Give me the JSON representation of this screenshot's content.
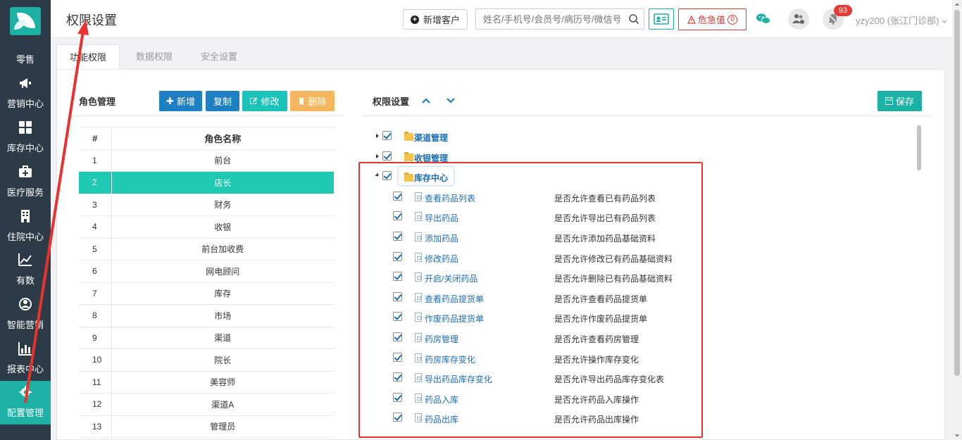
{
  "sidebar": {
    "items": [
      {
        "label": "零售",
        "icon": "retail-icon"
      },
      {
        "label": "营销中心",
        "icon": "megaphone-icon"
      },
      {
        "label": "库存中心",
        "icon": "grid-icon"
      },
      {
        "label": "医疗服务",
        "icon": "medical-kit-icon"
      },
      {
        "label": "住院中心",
        "icon": "building-icon"
      },
      {
        "label": "有数",
        "icon": "trend-chart-icon"
      },
      {
        "label": "智能营销",
        "icon": "smart-marketing-icon"
      },
      {
        "label": "报表中心",
        "icon": "bar-chart-icon"
      },
      {
        "label": "配置管理",
        "icon": "gear-icon"
      }
    ]
  },
  "header": {
    "title": "权限设置",
    "add_customer": "新增客户",
    "search_placeholder": "姓名/手机号/会员号/病历号/微信号",
    "danger_label": "危急值",
    "danger_count": "0",
    "notification_count": "93",
    "user": "yzy200 (张江门诊部)"
  },
  "tabs": [
    "功能权限",
    "数据权限",
    "安全设置"
  ],
  "role_panel": {
    "title": "角色管理",
    "buttons": {
      "add": "新增",
      "copy": "复制",
      "edit": "修改",
      "delete": "删除"
    },
    "columns": [
      "#",
      "角色名称"
    ],
    "rows": [
      {
        "num": "1",
        "name": "前台"
      },
      {
        "num": "2",
        "name": "店长"
      },
      {
        "num": "3",
        "name": "财务"
      },
      {
        "num": "4",
        "name": "收银"
      },
      {
        "num": "5",
        "name": "前台加收费"
      },
      {
        "num": "6",
        "name": "网电顾问"
      },
      {
        "num": "7",
        "name": "库存"
      },
      {
        "num": "8",
        "name": "市场"
      },
      {
        "num": "9",
        "name": "渠道"
      },
      {
        "num": "10",
        "name": "院长"
      },
      {
        "num": "11",
        "name": "美容师"
      },
      {
        "num": "12",
        "name": "渠道A"
      },
      {
        "num": "13",
        "name": "管理员"
      }
    ],
    "selected_row": "2"
  },
  "perm_panel": {
    "title": "权限设置",
    "save": "保存",
    "groups": [
      "渠道管理",
      "收银管理",
      "库存中心"
    ],
    "permissions": [
      {
        "name": "查看药品列表",
        "desc": "是否允许查看已有药品列表"
      },
      {
        "name": "导出药品",
        "desc": "是否允许导出已有药品列表"
      },
      {
        "name": "添加药品",
        "desc": "是否允许添加药品基础资料"
      },
      {
        "name": "修改药品",
        "desc": "是否允许修改已有药品基础资料"
      },
      {
        "name": "开启/关闭药品",
        "desc": "是否允许删除已有药品基础资料"
      },
      {
        "name": "查看药品提货单",
        "desc": "是否允许查看药品提货单"
      },
      {
        "name": "作废药品提货单",
        "desc": "是否允许作废药品提货单"
      },
      {
        "name": "药房管理",
        "desc": "是否允许查看药房管理"
      },
      {
        "name": "药房库存变化",
        "desc": "是否允许操作库存变化"
      },
      {
        "name": "导出药品库存变化",
        "desc": "是否允许导出药品库存变化表"
      },
      {
        "name": "药品入库",
        "desc": "是否允许药品入库操作"
      },
      {
        "name": "药品出库",
        "desc": "是否允许药品出库操作"
      }
    ]
  },
  "colors": {
    "sidebar": "#2c3b47",
    "accent": "#1cb1a4",
    "selected_row": "#1ec8b1",
    "primary_blue": "#1e7fc2",
    "danger": "#e53935",
    "annotation": "#e8322e"
  }
}
